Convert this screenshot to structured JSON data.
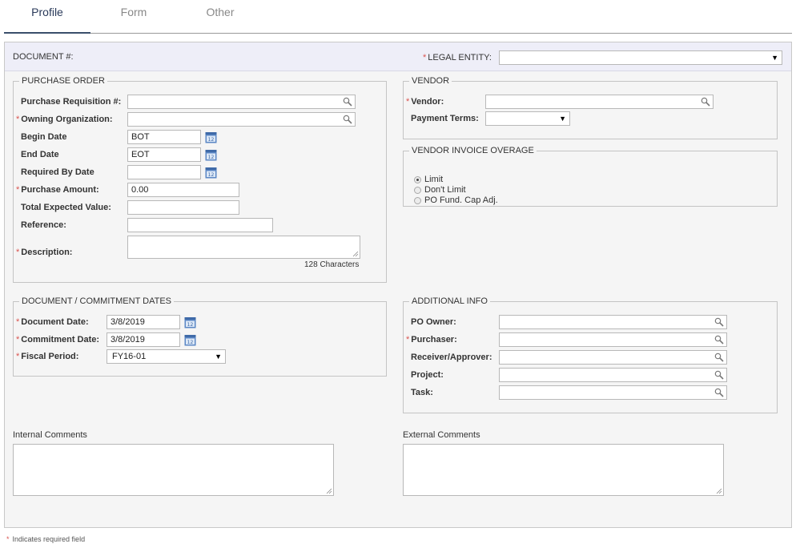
{
  "tabs": [
    {
      "label": "Profile",
      "active": true
    },
    {
      "label": "Form",
      "active": false
    },
    {
      "label": "Other",
      "active": false
    }
  ],
  "doc_bar": {
    "document_label": "DOCUMENT #:",
    "legal_entity_label": "LEGAL ENTITY:",
    "legal_entity_value": ""
  },
  "purchase_order": {
    "legend": "PURCHASE ORDER",
    "purchase_requisition_label": "Purchase Requisition #:",
    "purchase_requisition_value": "",
    "owning_org_label": "Owning Organization:",
    "owning_org_value": "",
    "begin_date_label": "Begin Date",
    "begin_date_value": "BOT",
    "end_date_label": "End Date",
    "end_date_value": "EOT",
    "required_by_label": "Required By Date",
    "required_by_value": "",
    "purchase_amount_label": "Purchase Amount:",
    "purchase_amount_value": "0.00",
    "total_expected_label": "Total Expected Value:",
    "total_expected_value": "",
    "reference_label": "Reference:",
    "reference_value": "",
    "description_label": "Description:",
    "description_value": "",
    "char_counter": "128 Characters"
  },
  "vendor": {
    "legend": "VENDOR",
    "vendor_label": "Vendor:",
    "vendor_value": "",
    "payment_terms_label": "Payment Terms:",
    "payment_terms_value": ""
  },
  "vendor_invoice_overage": {
    "legend": "VENDOR INVOICE OVERAGE",
    "options": [
      "Limit",
      "Don't Limit",
      "PO Fund. Cap Adj."
    ],
    "selected": "Limit"
  },
  "dates": {
    "legend": "DOCUMENT / COMMITMENT DATES",
    "document_date_label": "Document Date:",
    "document_date_value": "3/8/2019",
    "commitment_date_label": "Commitment Date:",
    "commitment_date_value": "3/8/2019",
    "fiscal_period_label": "Fiscal Period:",
    "fiscal_period_value": "FY16-01"
  },
  "additional_info": {
    "legend": "ADDITIONAL INFO",
    "po_owner_label": "PO Owner:",
    "purchaser_label": "Purchaser:",
    "receiver_label": "Receiver/Approver:",
    "project_label": "Project:",
    "task_label": "Task:"
  },
  "comments": {
    "internal_label": "Internal Comments",
    "external_label": "External Comments"
  },
  "footer": {
    "required_note": "Indicates required field",
    "required_marker": "*"
  },
  "colors": {
    "required": "#d9534f",
    "calendar_icon": "#5b87c5",
    "active_tab": "#2a3a5a"
  }
}
